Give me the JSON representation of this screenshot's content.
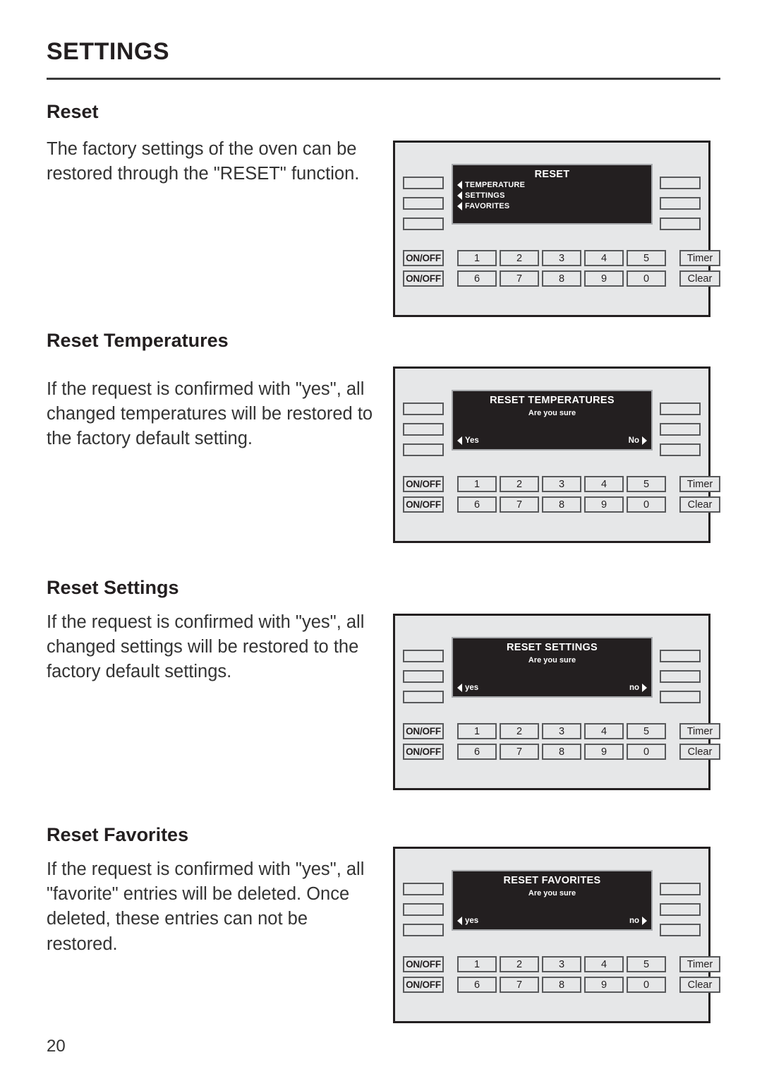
{
  "page": {
    "title": "SETTINGS",
    "number": "20"
  },
  "sections": [
    {
      "heading": "Reset",
      "body": "The factory settings of the oven can be restored through the \"RESET\" function."
    },
    {
      "heading": "Reset Temperatures",
      "body": "If the request is confirmed with \"yes\", all changed temperatures will be restored to the factory default setting."
    },
    {
      "heading": "Reset Settings",
      "body": "If the request is confirmed with \"yes\", all changed settings will be restored to the factory default settings."
    },
    {
      "heading": "Reset Favorites",
      "body": "If the request is confirmed with \"yes\", all \"favorite\" entries will be deleted. Once deleted, these entries can not be restored."
    }
  ],
  "keypad": {
    "onoff_label": "ON/OFF",
    "row1": [
      "1",
      "2",
      "3",
      "4",
      "5"
    ],
    "row2": [
      "6",
      "7",
      "8",
      "9",
      "0"
    ],
    "timer_label": "Timer",
    "clear_label": "Clear"
  },
  "panels": [
    {
      "name": "reset-menu",
      "display_title": "RESET",
      "menu_items": [
        "TEMPERATURE",
        "SETTINGS",
        "FAVORITES"
      ]
    },
    {
      "name": "reset-temperatures-confirm",
      "display_title": "RESET TEMPERATURES",
      "display_subtitle": "Are you sure",
      "yes_label": "Yes",
      "no_label": "No"
    },
    {
      "name": "reset-settings-confirm",
      "display_title": "RESET SETTINGS",
      "display_subtitle": "Are you sure",
      "yes_label": "yes",
      "no_label": "no"
    },
    {
      "name": "reset-favorites-confirm",
      "display_title": "RESET FAVORITES",
      "display_subtitle": "Are you sure",
      "yes_label": "yes",
      "no_label": "no"
    }
  ],
  "colors": {
    "panel_background": "#e6e7e8",
    "display_background": "#231f20",
    "display_text": "#ffffff",
    "key_border": "#58595b",
    "page_text": "#231f20"
  }
}
